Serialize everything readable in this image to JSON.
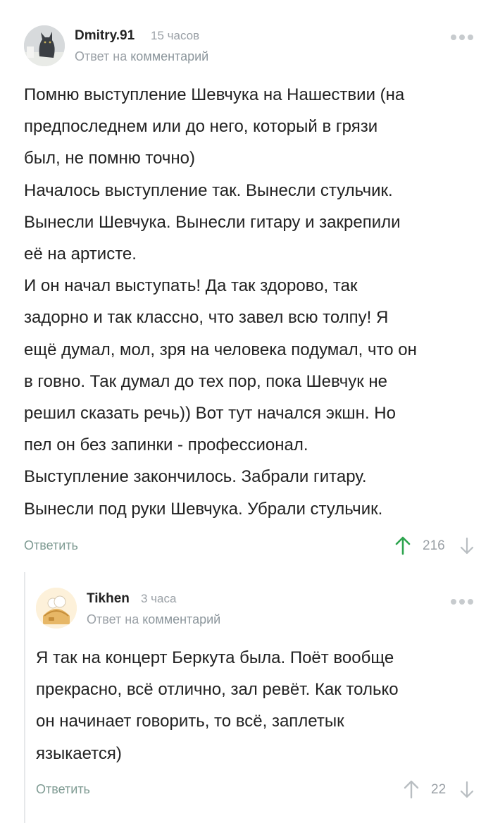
{
  "comments": [
    {
      "author": "Dmitry.91",
      "time": "15 часов",
      "reply_prefix": "Ответ на",
      "reply_link": "комментарий",
      "lines": [
        "Помню выступление Шевчука на Нашествии (на",
        "предпоследнем или до него, который в грязи",
        "был, не помню точно)",
        "Началось выступление так. Вынесли стульчик.",
        "Вынесли Шевчука. Вынесли гитару и закрепили",
        "её на артисте.",
        "И он начал выступать! Да так здорово, так",
        "задорно и так классно, что завел всю толпу! Я",
        "ещё думал, мол, зря на человека подумал, что он",
        "в говно. Так думал до тех пор, пока Шевчук не",
        "решил сказать речь)) Вот тут начался экшн. Но",
        "пел он без запинки - профессионал.",
        "Выступление закончилось. Забрали гитару.",
        "Вынесли под руки Шевчука. Убрали стульчик."
      ],
      "reply_label": "Ответить",
      "rating": "216",
      "upvote_color": "#2ea44f"
    },
    {
      "author": "Tikhen",
      "time": "3 часа",
      "reply_prefix": "Ответ на",
      "reply_link": "комментарий",
      "lines": [
        "Я так на концерт Беркута была. Поёт вообще",
        "прекрасно, всё отлично, зал ревёт. Как только",
        "он начинает говорить, то всё, заплетык",
        "языкается)"
      ],
      "reply_label": "Ответить",
      "rating": "22",
      "upvote_color": "#b9bec2"
    }
  ],
  "icons": {
    "more": "more-dots-icon",
    "upvote": "arrow-up-icon",
    "downvote": "arrow-down-icon",
    "avatar1": "cat-avatar",
    "avatar2": "cartoon-avatar"
  }
}
